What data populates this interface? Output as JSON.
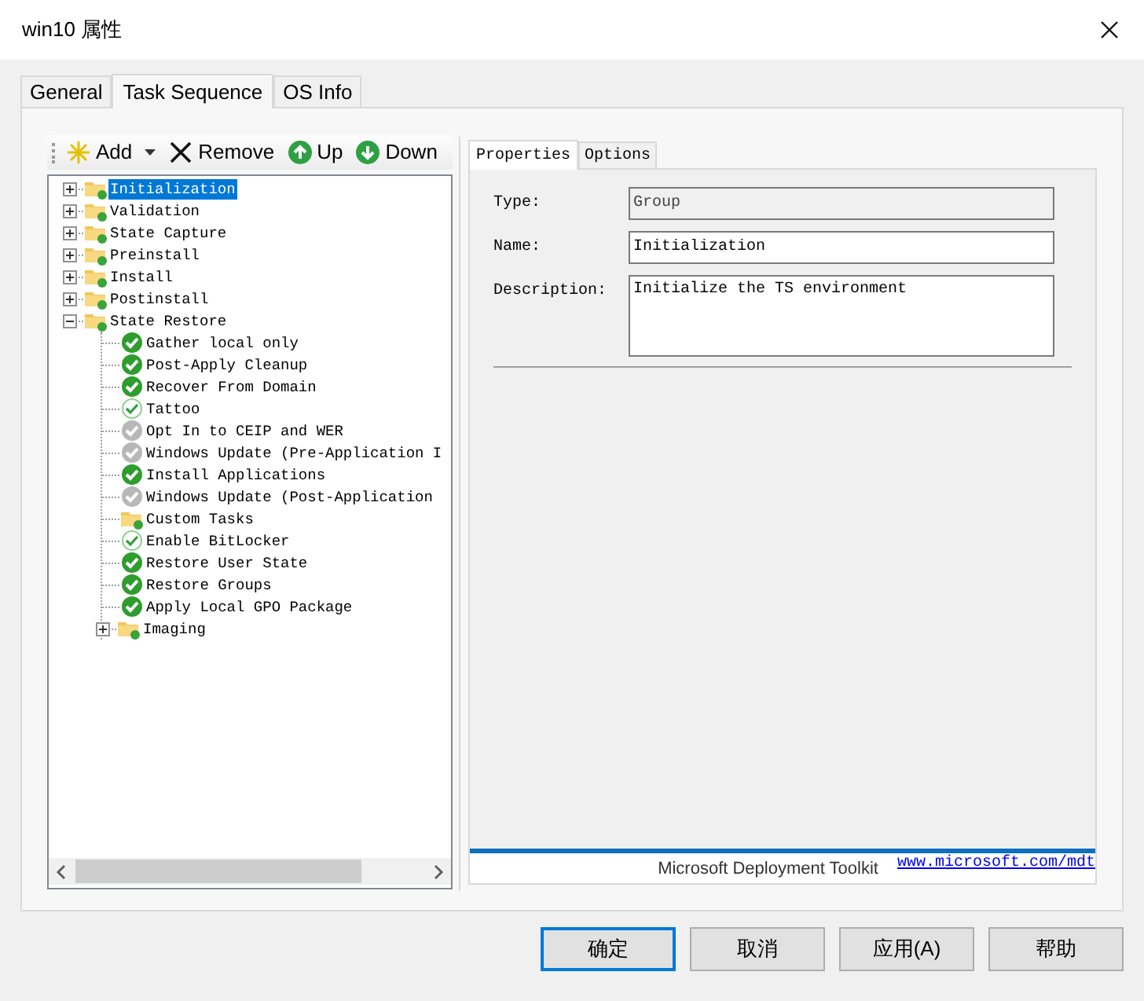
{
  "window": {
    "title": "win10 属性"
  },
  "tabs": [
    {
      "label": "General",
      "selected": false
    },
    {
      "label": "Task Sequence",
      "selected": true
    },
    {
      "label": "OS Info",
      "selected": false
    }
  ],
  "toolbar": [
    {
      "label": "Add",
      "kind": "add"
    },
    {
      "label": "Remove",
      "kind": "remove"
    },
    {
      "label": "Up",
      "kind": "up"
    },
    {
      "label": "Down",
      "kind": "down"
    }
  ],
  "tree": [
    {
      "label": "Initialization",
      "kind": "group",
      "expanded": false,
      "selected": true
    },
    {
      "label": "Validation",
      "kind": "group",
      "expanded": false,
      "selected": false
    },
    {
      "label": "State Capture",
      "kind": "group",
      "expanded": false,
      "selected": false
    },
    {
      "label": "Preinstall",
      "kind": "group",
      "expanded": false,
      "selected": false
    },
    {
      "label": "Install",
      "kind": "group",
      "expanded": false,
      "selected": false
    },
    {
      "label": "Postinstall",
      "kind": "group",
      "expanded": false,
      "selected": false
    },
    {
      "label": "State Restore",
      "kind": "group",
      "expanded": true,
      "selected": false,
      "children": [
        {
          "label": "Gather local only",
          "kind": "step",
          "disabled": false,
          "selected": false
        },
        {
          "label": "Post-Apply Cleanup",
          "kind": "step",
          "disabled": false,
          "selected": false
        },
        {
          "label": "Recover From Domain",
          "kind": "step",
          "disabled": false,
          "selected": false
        },
        {
          "label": "Tattoo",
          "kind": "step-light",
          "disabled": false,
          "selected": false
        },
        {
          "label": "Opt In to CEIP and WER",
          "kind": "step",
          "disabled": true,
          "selected": false
        },
        {
          "label": "Windows Update (Pre-Application I",
          "kind": "step",
          "disabled": true,
          "selected": false
        },
        {
          "label": "Install Applications",
          "kind": "step",
          "disabled": false,
          "selected": false
        },
        {
          "label": "Windows Update (Post-Application",
          "kind": "step",
          "disabled": true,
          "selected": false
        },
        {
          "label": "Custom Tasks",
          "kind": "group",
          "selected": false
        },
        {
          "label": "Enable BitLocker",
          "kind": "step-light",
          "disabled": false,
          "selected": false
        },
        {
          "label": "Restore User State",
          "kind": "step",
          "disabled": false,
          "selected": false
        },
        {
          "label": "Restore Groups",
          "kind": "step",
          "disabled": false,
          "selected": false
        },
        {
          "label": "Apply Local GPO Package",
          "kind": "step",
          "disabled": false,
          "selected": false
        },
        {
          "label": "Imaging",
          "kind": "group",
          "expanded": false,
          "selected": false
        }
      ]
    }
  ],
  "detail_tabs": [
    {
      "label": "Properties",
      "selected": true
    },
    {
      "label": "Options",
      "selected": false
    }
  ],
  "fields": [
    {
      "label": "Type:",
      "value": "Group",
      "kind": "text",
      "disabled": true
    },
    {
      "label": "Name:",
      "value": "Initialization",
      "kind": "text",
      "disabled": false
    },
    {
      "label": "Description:",
      "value": "Initialize the TS environment",
      "kind": "multiline",
      "disabled": false
    }
  ],
  "footer": {
    "text": "Microsoft Deployment Toolkit",
    "link": "www.microsoft.com/mdt"
  },
  "buttons": [
    {
      "label": "确定",
      "default": true
    },
    {
      "label": "取消",
      "default": false
    },
    {
      "label": "应用(A)",
      "default": false
    },
    {
      "label": "帮助",
      "default": false
    }
  ]
}
